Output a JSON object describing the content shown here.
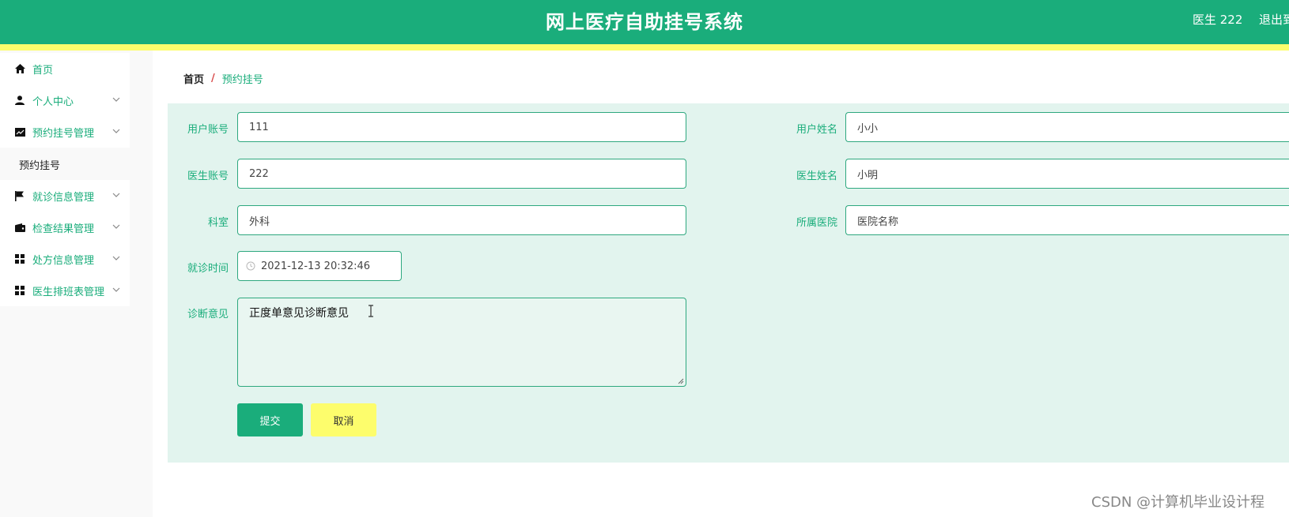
{
  "header": {
    "title": "网上医疗自助挂号系统",
    "user": "医生 222",
    "logout": "退出到前台"
  },
  "colors": {
    "primary": "#1aad7b",
    "accent": "#fdfd6c",
    "panel": "#e2f4ee"
  },
  "sidebar": {
    "items": [
      {
        "label": "首页",
        "icon": "home-icon"
      },
      {
        "label": "个人中心",
        "icon": "user-icon"
      },
      {
        "label": "预约挂号管理",
        "icon": "chart-icon"
      },
      {
        "label": "就诊信息管理",
        "icon": "flag-icon"
      },
      {
        "label": "检查结果管理",
        "icon": "wallet-icon"
      },
      {
        "label": "处方信息管理",
        "icon": "grid-icon"
      },
      {
        "label": "医生排班表管理",
        "icon": "grid-icon"
      }
    ],
    "submenu": [
      {
        "label": "预约挂号"
      }
    ]
  },
  "breadcrumb": {
    "home": "首页",
    "separator": "/",
    "current": "预约挂号"
  },
  "form": {
    "user_account": {
      "label": "用户账号",
      "value": "111"
    },
    "user_name": {
      "label": "用户姓名",
      "value": "小小"
    },
    "doctor_account": {
      "label": "医生账号",
      "value": "222"
    },
    "doctor_name": {
      "label": "医生姓名",
      "value": "小明"
    },
    "department": {
      "label": "科室",
      "value": "外科"
    },
    "hospital": {
      "label": "所属医院",
      "value": "医院名称"
    },
    "visit_time": {
      "label": "就诊时间",
      "value": "2021-12-13 20:32:46"
    },
    "diagnosis": {
      "label": "诊断意见",
      "value": "正度单意见诊断意见"
    },
    "submit_label": "提交",
    "cancel_label": "取消"
  },
  "watermark": "CSDN @计算机毕业设计程"
}
